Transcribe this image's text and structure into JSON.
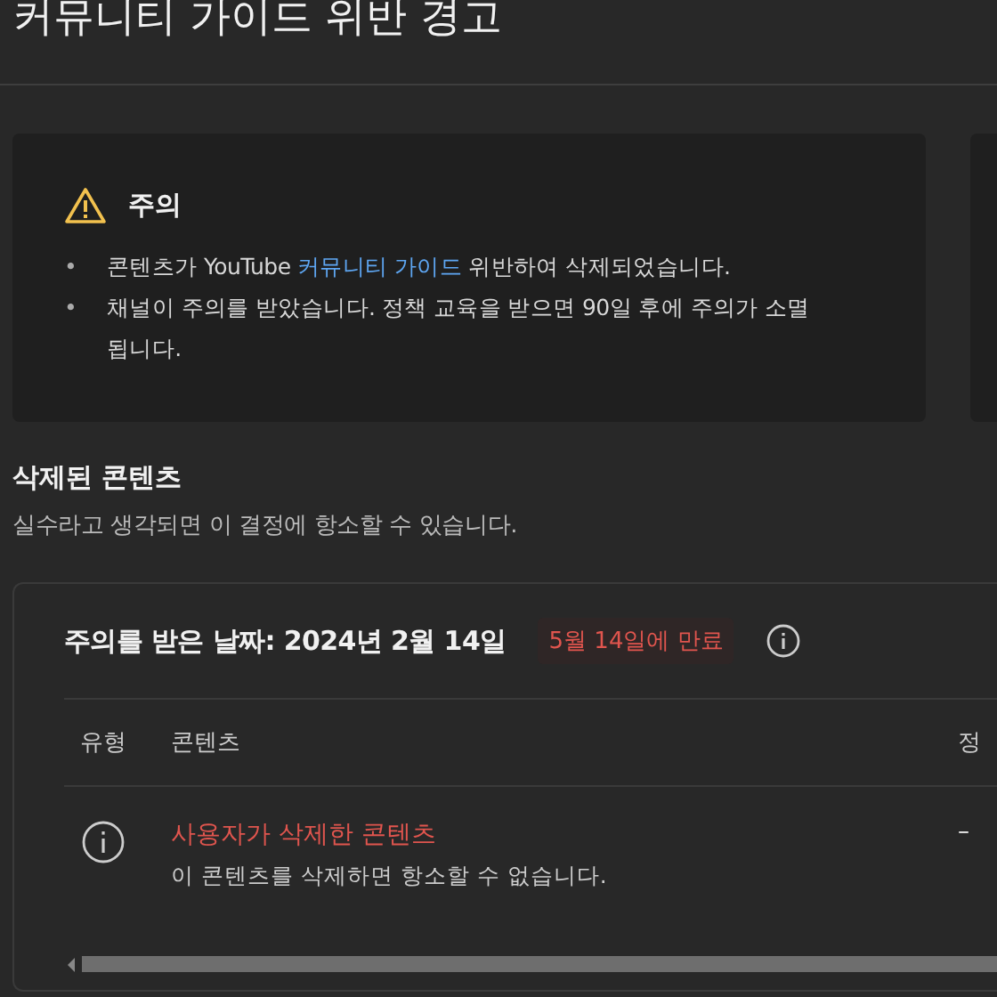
{
  "page_title": "커뮤니티 가이드 위반 경고",
  "notice": {
    "heading": "주의",
    "bullets": [
      {
        "marker": "•",
        "text": "콘텐츠가 YouTube ",
        "link": "커뮤니티 가이드",
        "after": " 위반하여 삭제되었습니다."
      },
      {
        "marker": "•",
        "text": "채널이 주의를 받았습니다. 정책 교육을 받으면 90일 후에 주의가 소멸됩니다."
      }
    ]
  },
  "section": {
    "title": "삭제된 콘텐츠",
    "subtitle": "실수라고 생각되면 이 결정에 항소할 수 있습니다."
  },
  "strike": {
    "date_label": "주의를 받은 날짜: **2024년 2월 14일**",
    "expiry": "5월 14일에 만료",
    "columns": [
      "유형",
      "콘텐츠",
      "정"
    ],
    "rows": [
      {
        "title": "사용자가 삭제한 콘텐츠",
        "note": "이 콘텐츠를 삭제하면 항소할 수 없습니다.",
        "column_3": "–"
      }
    ]
  }
}
